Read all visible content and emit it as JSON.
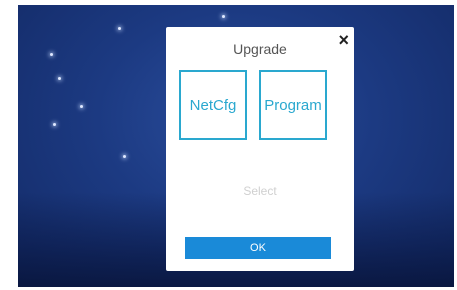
{
  "dialog": {
    "title": "Upgrade",
    "close_icon": "×",
    "options": [
      {
        "label": "NetCfg"
      },
      {
        "label": "Program"
      }
    ],
    "select_text": "Select",
    "ok_label": "OK"
  },
  "colors": {
    "accent": "#2aa8cf",
    "button": "#1a8ad8",
    "background": "#1c3a82"
  }
}
